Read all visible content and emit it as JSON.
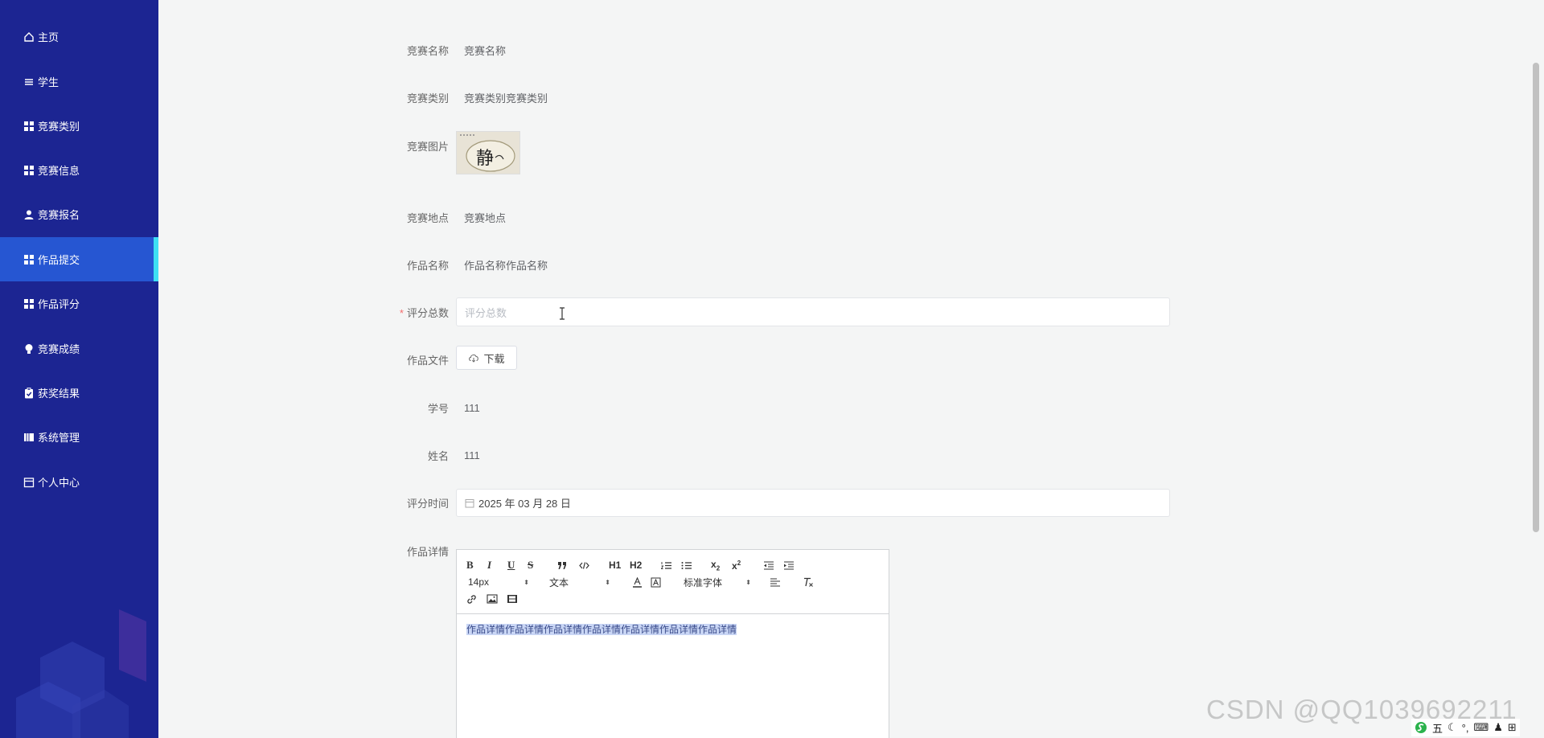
{
  "sidebar": {
    "items": [
      {
        "label": "主页",
        "icon": "home-icon"
      },
      {
        "label": "学生",
        "icon": "list-icon"
      },
      {
        "label": "竞赛类别",
        "icon": "grid-icon"
      },
      {
        "label": "竞赛信息",
        "icon": "grid-icon"
      },
      {
        "label": "竞赛报名",
        "icon": "user-icon"
      },
      {
        "label": "作品提交",
        "icon": "grid-icon",
        "active": true
      },
      {
        "label": "作品评分",
        "icon": "grid-icon"
      },
      {
        "label": "竞赛成绩",
        "icon": "bulb-icon"
      },
      {
        "label": "获奖结果",
        "icon": "clipboard-icon"
      },
      {
        "label": "系统管理",
        "icon": "book-icon"
      },
      {
        "label": "个人中心",
        "icon": "calendar-icon"
      }
    ],
    "accent": "#3ee0f3",
    "background": "#1c2592"
  },
  "form": {
    "competition_name": {
      "label": "竞赛名称",
      "value": "竞赛名称"
    },
    "competition_category": {
      "label": "竞赛类别",
      "value": "竞赛类别竞赛类别"
    },
    "competition_image": {
      "label": "竞赛图片",
      "image_text": "静"
    },
    "competition_location": {
      "label": "竞赛地点",
      "value": "竞赛地点"
    },
    "work_name": {
      "label": "作品名称",
      "value": "作品名称作品名称"
    },
    "total_score": {
      "label": "评分总数",
      "required_mark": "*",
      "placeholder": "评分总数"
    },
    "work_file": {
      "label": "作品文件",
      "button": "下载"
    },
    "student_id": {
      "label": "学号",
      "value": "111"
    },
    "name": {
      "label": "姓名",
      "value": "111"
    },
    "score_time": {
      "label": "评分时间",
      "value": "2025 年 03 月 28 日"
    },
    "work_details": {
      "label": "作品详情",
      "toolbar": {
        "font_size": "14px",
        "paragraph": "文本",
        "font_family": "标准字体",
        "h1": "H1",
        "h2": "H2"
      },
      "content": "作品详情作品详情作品详情作品详情作品详情作品详情作品详情"
    }
  },
  "watermark": "CSDN @QQ1039692211",
  "tray": {
    "ime": "五"
  }
}
